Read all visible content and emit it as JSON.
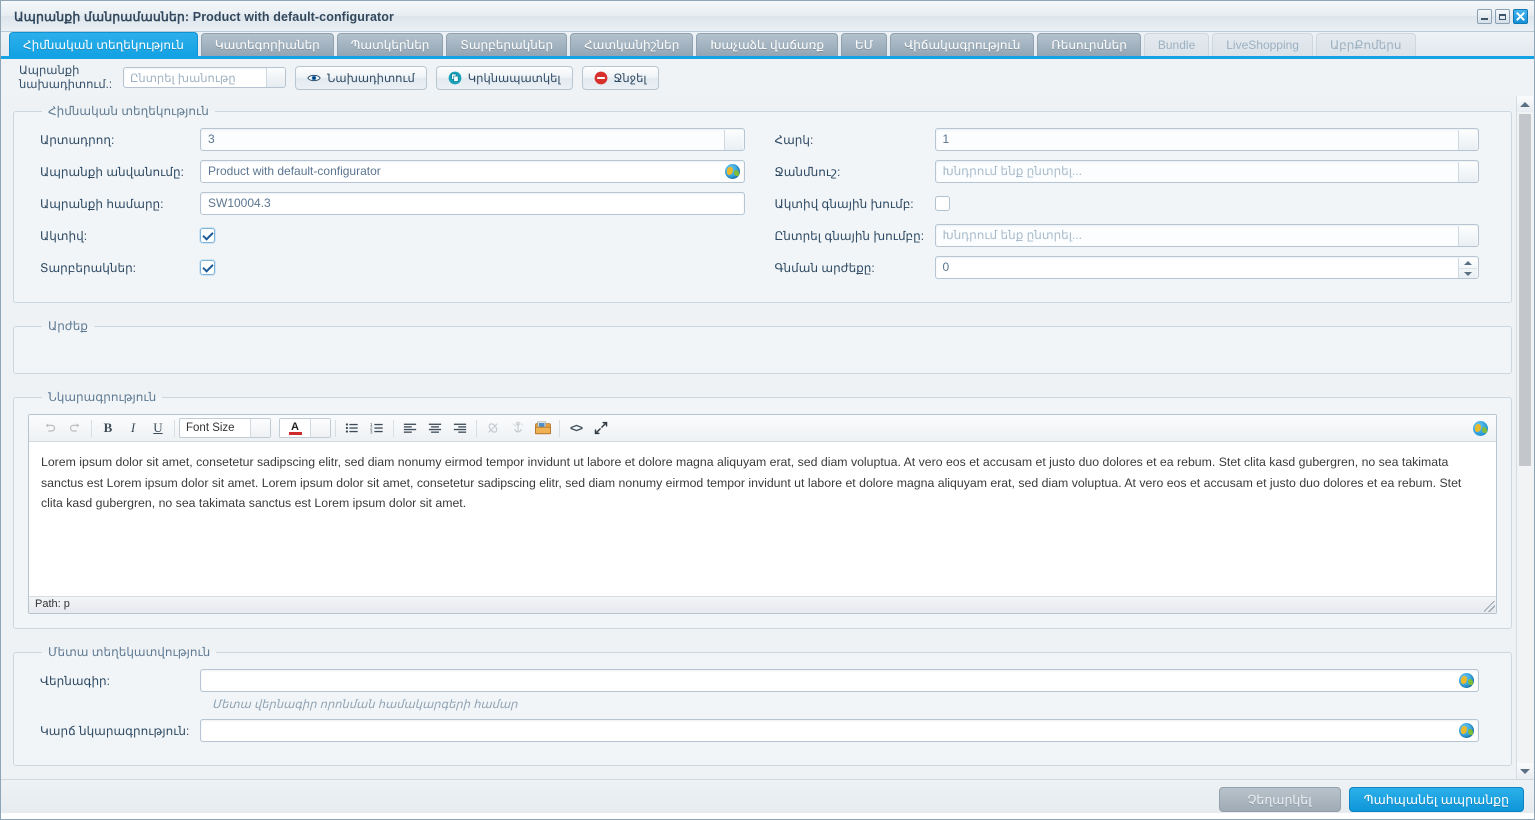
{
  "window": {
    "title": "Ապրանքի մանրամասներ: Product with default-configurator",
    "minimize_label": "—",
    "maximize_label": "□",
    "close_label": "✕"
  },
  "tabs": [
    {
      "label": "Հիմնական տեղեկություն",
      "state": "active"
    },
    {
      "label": "Կատեգորիաներ",
      "state": "normal"
    },
    {
      "label": "Պատկերներ",
      "state": "normal"
    },
    {
      "label": "Տարբերակներ",
      "state": "normal"
    },
    {
      "label": "Հատկանիշներ",
      "state": "normal"
    },
    {
      "label": "Խաչաձև վաճառք",
      "state": "normal"
    },
    {
      "label": "ԵՄ",
      "state": "normal"
    },
    {
      "label": "Վիճակագրություն",
      "state": "normal"
    },
    {
      "label": "Ռեսուրսներ",
      "state": "normal"
    },
    {
      "label": "Bundle",
      "state": "disabled"
    },
    {
      "label": "LiveShopping",
      "state": "disabled"
    },
    {
      "label": "ԱբրՔոմերս",
      "state": "disabled"
    }
  ],
  "actionbar": {
    "preview_label_line1": "Ապրանքի",
    "preview_label_line2": "նախադիտում.:",
    "shop_select_placeholder": "Ընտրել խանութը",
    "preview_button": "Նախադիտում",
    "duplicate_button": "Կրկնապատկել",
    "delete_button": "Ջնջել"
  },
  "basic_info": {
    "legend": "Հիմնական տեղեկություն",
    "left": [
      {
        "label": "Արտադրող:",
        "value": "3",
        "type": "select"
      },
      {
        "label": "Ապրանքի անվանումը:",
        "value": "Product with default-configurator",
        "type": "text-globe"
      },
      {
        "label": "Ապրանքի համարը:",
        "value": "SW10004.3",
        "type": "text"
      },
      {
        "label": "Ակտիվ:",
        "value": "",
        "type": "checkbox-checked"
      },
      {
        "label": "Տարբերակներ:",
        "value": "",
        "type": "checkbox-checked"
      }
    ],
    "right": [
      {
        "label": "Հարկ:",
        "value": "1",
        "type": "select"
      },
      {
        "label": "Ջանմնուշ:",
        "value": "Խնդրում ենք ընտրել...",
        "type": "select-placeholder"
      },
      {
        "label": "Ակտիվ գնային խումբ:",
        "value": "",
        "type": "checkbox-unchecked"
      },
      {
        "label": "Ընտրել գնային խումբը:",
        "value": "Խնդրում ենք ընտրել...",
        "type": "select-placeholder"
      },
      {
        "label": "Գնման արժեքը:",
        "value": "0",
        "type": "spinner"
      }
    ]
  },
  "prices": {
    "legend": "Արժեք"
  },
  "description": {
    "legend": "Նկարագրություն",
    "toolbar": {
      "undo": "undo-icon",
      "redo": "redo-icon",
      "bold": "B",
      "italic": "I",
      "underline": "U",
      "font_size": "Font Size",
      "text_color": "A",
      "bullet_list": "bullet-list-icon",
      "numbered_list": "numbered-list-icon",
      "align_left": "align-left-icon",
      "align_center": "align-center-icon",
      "align_right": "align-right-icon",
      "unlink": "unlink-icon",
      "anchor": "anchor-icon",
      "media": "media-icon",
      "source_code": "<>",
      "fullscreen": "fullscreen-icon"
    },
    "body": "Lorem ipsum dolor sit amet, consetetur sadipscing elitr, sed diam nonumy eirmod tempor invidunt ut labore et dolore magna aliquyam erat, sed diam voluptua. At vero eos et accusam et justo duo dolores et ea rebum. Stet clita kasd gubergren, no sea takimata sanctus est Lorem ipsum dolor sit amet. Lorem ipsum dolor sit amet, consetetur sadipscing elitr, sed diam nonumy eirmod tempor invidunt ut labore et dolore magna aliquyam erat, sed diam voluptua. At vero eos et accusam et justo duo dolores et ea rebum. Stet clita kasd gubergren, no sea takimata sanctus est Lorem ipsum dolor sit amet.",
    "path": "Path: p"
  },
  "meta": {
    "legend": "Մետա տեղեկատվություն",
    "title_label": "Վերնագիր:",
    "title_value": "",
    "title_hint": "Մետա վերնագիր որոնման համակարգերի համար",
    "short_desc_label": "Կարճ նկարագրություն:",
    "short_desc_value": ""
  },
  "footer": {
    "cancel_label": "Չեղարկել",
    "save_label": "Պահպանել ապրանքը"
  },
  "colors": {
    "accent": "#13a2e4",
    "tab_inactive": "#93a5b4",
    "label_text": "#2f4a63",
    "legend_text": "#5f7a92",
    "delete_red": "#d9302c",
    "duplicate_teal": "#16a3b8"
  }
}
